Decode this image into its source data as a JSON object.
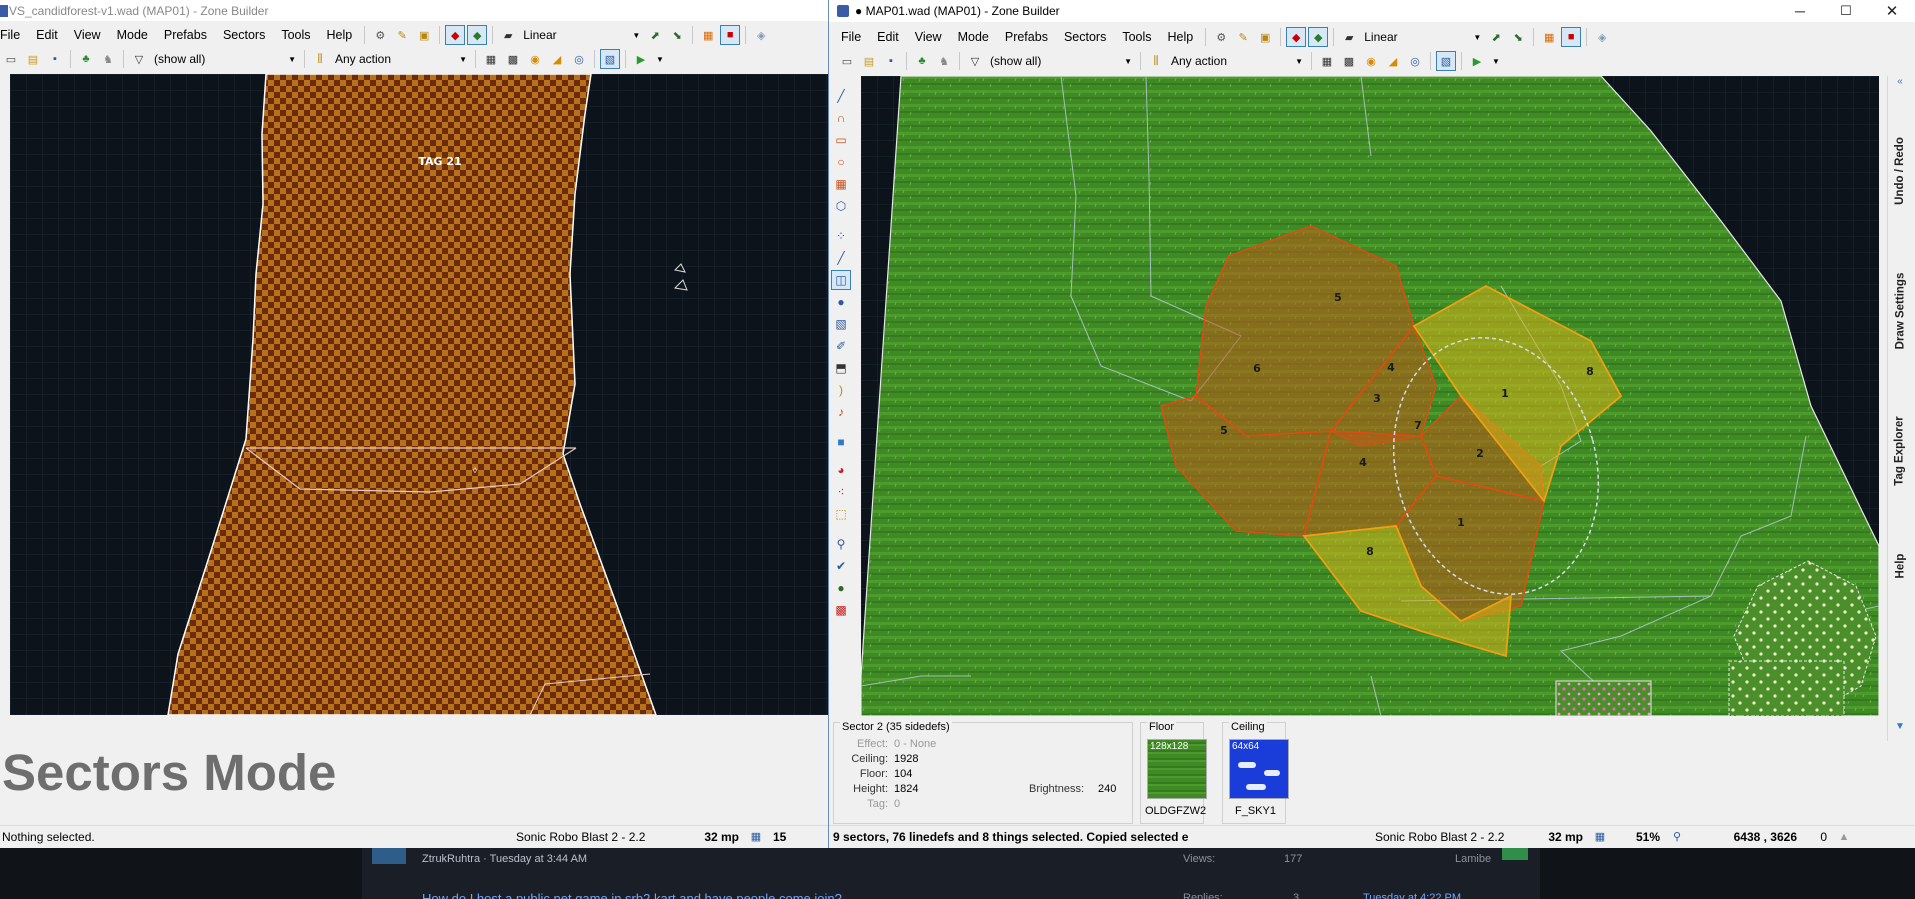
{
  "left_window": {
    "title": "VS_candidforest-v1.wad (MAP01) - Zone Builder",
    "menu": [
      "File",
      "Edit",
      "View",
      "Mode",
      "Prefabs",
      "Sectors",
      "Tools",
      "Help"
    ],
    "view_mode": "Linear",
    "filter": "(show all)",
    "action_filter": "Any action",
    "sector_tag_label": "TAG 21",
    "mode_overlay": "Sectors Mode",
    "status": {
      "message": "Nothing selected.",
      "game": "Sonic Robo Blast 2 - 2.2",
      "grid": "32 mp",
      "zoom_partial": "15"
    }
  },
  "right_window": {
    "title": "● MAP01.wad (MAP01) - Zone Builder",
    "menu": [
      "File",
      "Edit",
      "View",
      "Mode",
      "Prefabs",
      "Sectors",
      "Tools",
      "Help"
    ],
    "view_mode": "Linear",
    "filter": "(show all)",
    "action_filter": "Any action",
    "side_tabs": [
      "Undo / Redo",
      "Draw Settings",
      "Tag Explorer",
      "Help"
    ],
    "sector_labels": [
      "5",
      "6",
      "4",
      "3",
      "7",
      "1",
      "8",
      "5",
      "4",
      "2",
      "1",
      "8"
    ],
    "sector_info": {
      "heading": "Sector 2 (35 sidedefs)",
      "effect_label": "Effect:",
      "effect_value": "0 - None",
      "ceiling_label": "Ceiling:",
      "ceiling_value": "1928",
      "floor_label": "Floor:",
      "floor_value": "104",
      "height_label": "Height:",
      "height_value": "1824",
      "tag_label": "Tag:",
      "tag_value": "0",
      "brightness_label": "Brightness:",
      "brightness_value": "240"
    },
    "floor_tex": {
      "label": "Floor",
      "size": "128x128",
      "name": "OLDGFZW2"
    },
    "ceiling_tex": {
      "label": "Ceiling",
      "size": "64x64",
      "name": "F_SKY1"
    },
    "status": {
      "message": "9 sectors, 76 linedefs and 8 things selected. Copied selected e",
      "game": "Sonic Robo Blast 2 - 2.2",
      "grid": "32 mp",
      "zoom": "51%",
      "coords": "6438  ,  3626",
      "extra": "0"
    }
  },
  "taskbar_bg": {
    "author_line": "ZtrukRuhtra · Tuesday at 3:44 AM",
    "views_label": "Views:",
    "views_value": "177",
    "last_user": "Lamibe",
    "thread_title": "How do I host a public net game in srb2 kart and have people come join?",
    "replies_label": "Replies:",
    "replies_value": "3",
    "last_time": "Tuesday at 4:22 PM"
  },
  "colors": {
    "map_bg": "#0d131a",
    "grass": "#3f8a25",
    "selected_sector": "#e8a317",
    "highlight_sector": "#e04a10",
    "accent": "#0078d7"
  }
}
